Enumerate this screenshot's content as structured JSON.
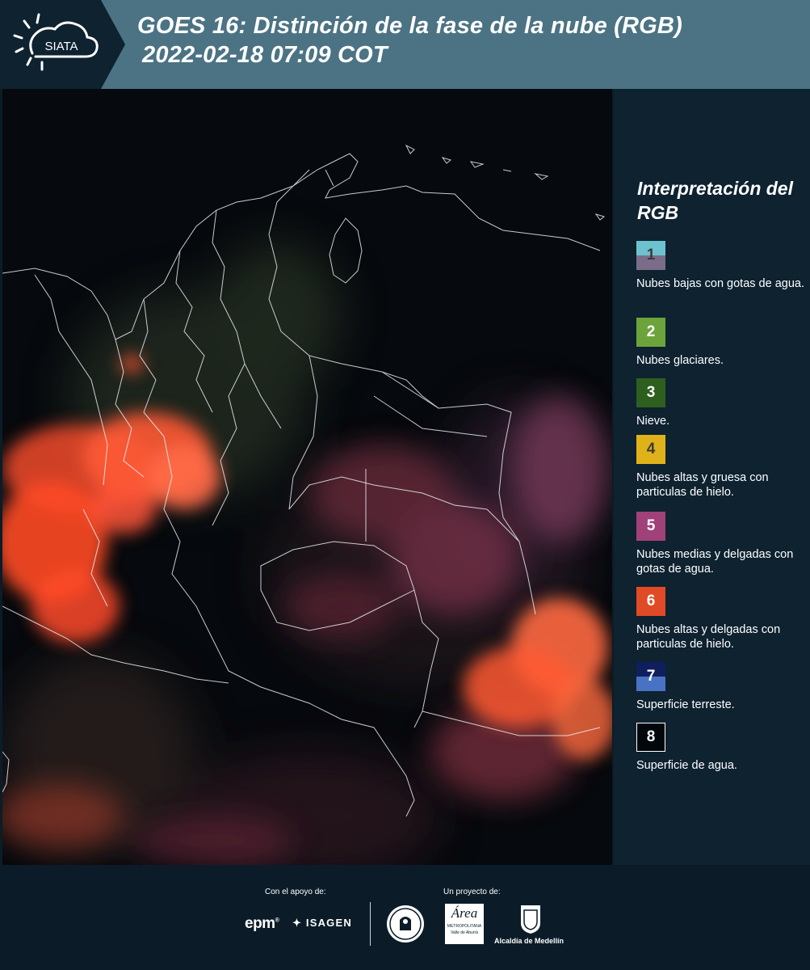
{
  "header": {
    "brand": "SIATA",
    "title_line1": "GOES 16: Distinción de la fase de la nube (RGB)",
    "title_line2": "2022-02-18 07:09 COT"
  },
  "colors": {
    "header_bg": "#4b7383",
    "logo_bg": "#0e2230",
    "panel_bg": "#0e2230",
    "page_bg": "#0b1c28"
  },
  "legend": {
    "title": "Interpretación del RGB",
    "items": [
      {
        "num": "1",
        "label": "Nubes bajas con gotas de agua.",
        "color_top": "#6cc3cf",
        "color_bottom": "#7b6d8a",
        "num_color": "#3a3a3a"
      },
      {
        "num": "2",
        "label": "Nubes glaciares.",
        "color_top": "#6ca33a",
        "color_bottom": "#6ca33a",
        "num_color": "#ffffff"
      },
      {
        "num": "3",
        "label": "Nieve.",
        "color_top": "#2e5f1f",
        "color_bottom": "#2e5f1f",
        "num_color": "#ffffff"
      },
      {
        "num": "4",
        "label": "Nubes altas y gruesa con particulas de hielo.",
        "color_top": "#e0b21a",
        "color_bottom": "#e0b21a",
        "num_color": "#3a3a3a"
      },
      {
        "num": "5",
        "label": "Nubes medias y delgadas con gotas de agua.",
        "color_top": "#a0417a",
        "color_bottom": "#a0417a",
        "num_color": "#ffffff"
      },
      {
        "num": "6",
        "label": "Nubes altas y delgadas con particulas de hielo.",
        "color_top": "#e04a26",
        "color_bottom": "#e04a26",
        "num_color": "#ffffff"
      },
      {
        "num": "7",
        "label": "Superficie terreste.",
        "color_top": "#0f1f5e",
        "color_bottom": "#4a72c4",
        "num_color": "#ffffff"
      },
      {
        "num": "8",
        "label": "Superficie de agua.",
        "color_top": "#02070b",
        "color_bottom": "#02070b",
        "num_color": "#ffffff"
      }
    ]
  },
  "footer": {
    "support_label": "Con el apoyo de:",
    "project_label": "Un proyecto de:",
    "sponsor_1": "epm",
    "sponsor_2": "ISAGEN",
    "partner_2_line1": "Área",
    "partner_2_line2": "METROPOLITANA",
    "partner_2_line3": "Valle de Aburrá",
    "partner_3": "Alcaldía de Medellín"
  }
}
